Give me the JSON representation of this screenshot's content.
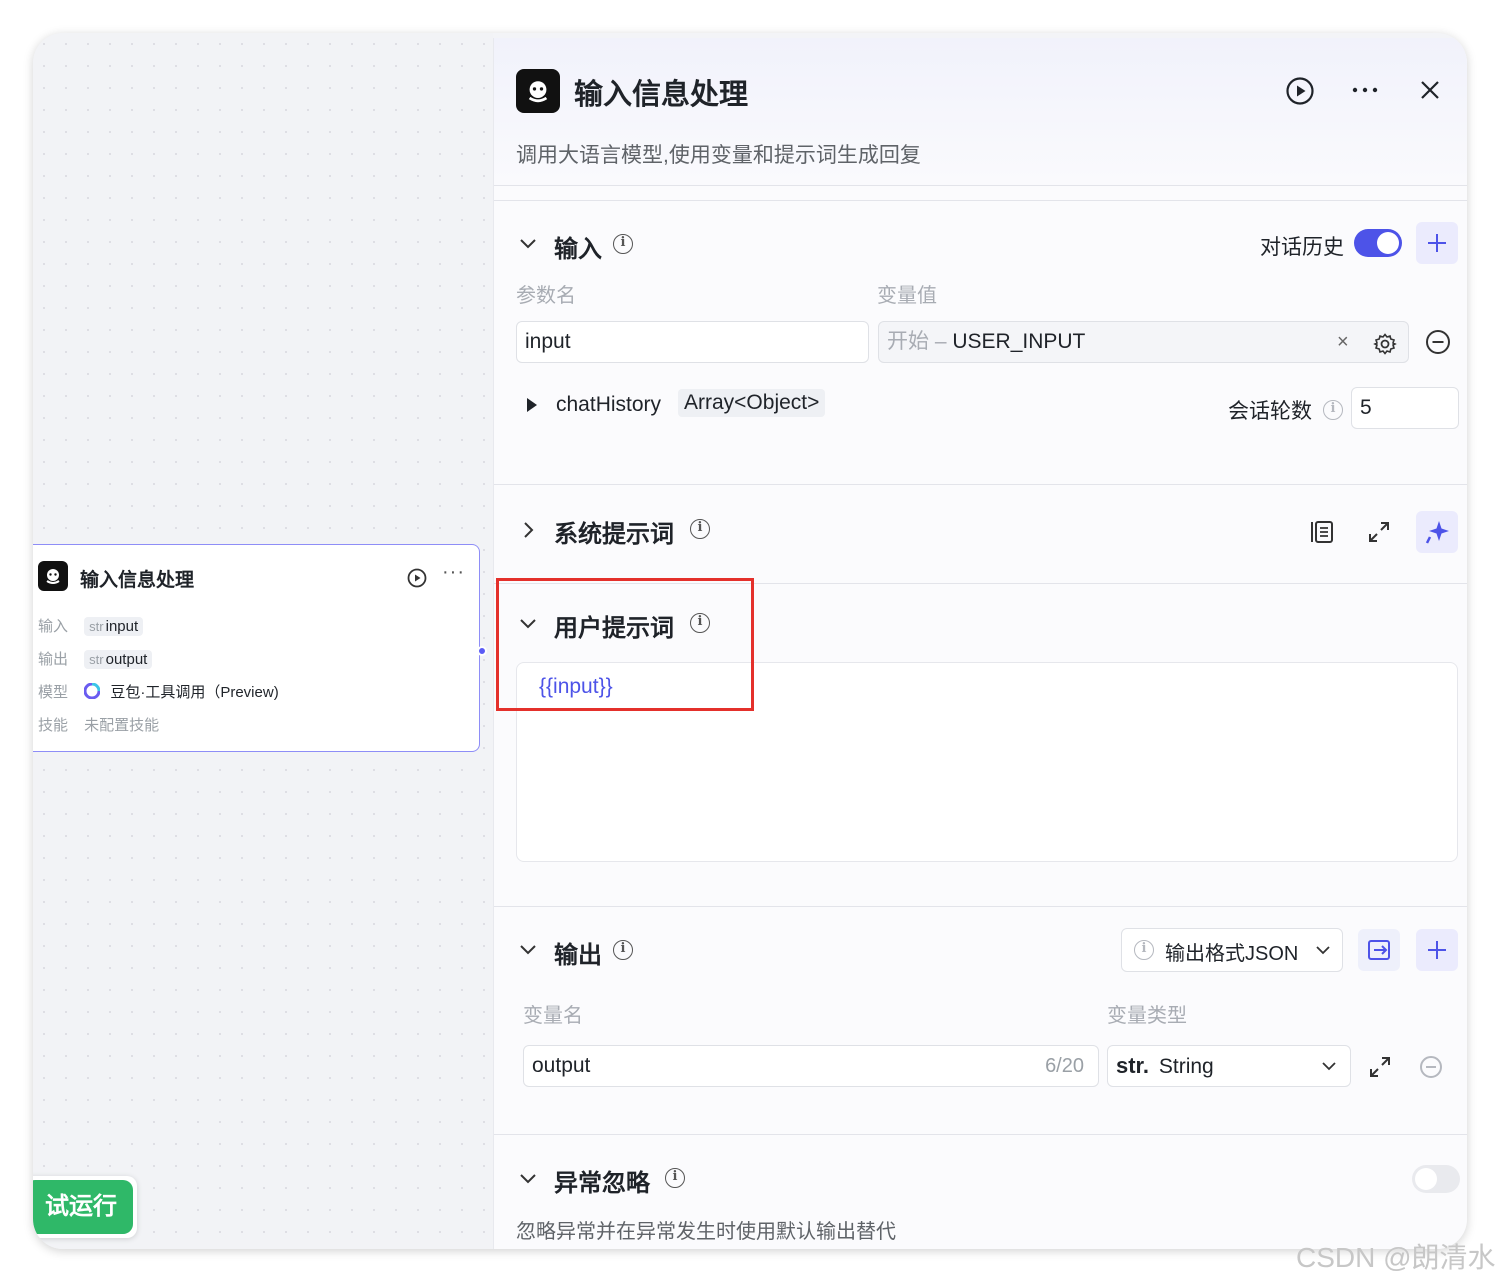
{
  "node": {
    "title": "输入信息处理",
    "rows": [
      {
        "label": "输入",
        "type": "str",
        "value": "input"
      },
      {
        "label": "输出",
        "type": "str",
        "value": "output"
      },
      {
        "label": "模型",
        "value": "豆包·工具调用（Preview)"
      },
      {
        "label": "技能",
        "value": "未配置技能"
      }
    ]
  },
  "try_run": {
    "label": "试运行"
  },
  "panel": {
    "title": "输入信息处理",
    "description": "调用大语言模型,使用变量和提示词生成回复",
    "input_section": {
      "title": "输入",
      "history_label": "对话历史",
      "history_enabled": true,
      "col_param": "参数名",
      "col_value": "变量值",
      "param_value": "input",
      "var_prefix": "开始 – ",
      "var_value": "USER_INPUT",
      "chat_history_name": "chatHistory",
      "chat_history_type": "Array<Object>",
      "rounds_label": "会话轮数",
      "rounds_value": "5"
    },
    "system_prompt": {
      "title": "系统提示词"
    },
    "user_prompt": {
      "title": "用户提示词",
      "content": "{{input}}"
    },
    "output_section": {
      "title": "输出",
      "format_label": "输出格式JSON",
      "col_name": "变量名",
      "col_type": "变量类型",
      "var_name": "output",
      "char_count": "6/20",
      "type_prefix": "str.",
      "type_value": "String"
    },
    "exception": {
      "title": "异常忽略",
      "enabled": false,
      "description": "忽略异常并在异常发生时使用默认输出替代"
    }
  },
  "watermark": "CSDN @朗清水",
  "colors": {
    "accent": "#4d53e8",
    "highlight": "#e4302b",
    "run_green": "#2fb868"
  }
}
